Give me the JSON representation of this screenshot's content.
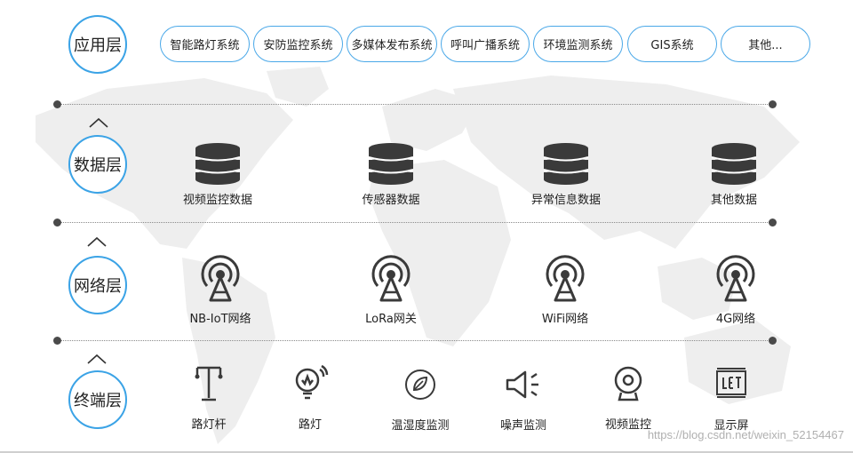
{
  "layers": {
    "application": "应用层",
    "data": "数据层",
    "network": "网络层",
    "terminal": "终端层"
  },
  "systems": [
    "智能路灯系统",
    "安防监控系统",
    "多媒体发布系统",
    "呼叫广播系统",
    "环境监测系统",
    "GIS系统",
    "其他..."
  ],
  "data_items": [
    "视频监控数据",
    "传感器数据",
    "异常信息数据",
    "其他数据"
  ],
  "network_items": [
    "NB-IoT网络",
    "LoRa网关",
    "WiFi网络",
    "4G网络"
  ],
  "terminal_items": [
    "路灯杆",
    "路灯",
    "温湿度监测",
    "噪声监测",
    "视频监控",
    "显示屏"
  ],
  "icons": {
    "database": "database-icon",
    "antenna": "antenna-icon",
    "pole": "light-pole-icon",
    "bulb": "bulb-icon",
    "leaf": "leaf-icon",
    "speaker": "speaker-icon",
    "camera": "camera-icon",
    "display": "display-screen-icon",
    "chevron": "chevron-up-icon"
  },
  "colors": {
    "accent": "#3ba3e6",
    "icon": "#3a3a3a",
    "map": "#eeeeee"
  },
  "watermark": "https://blog.csdn.net/weixin_52154467"
}
